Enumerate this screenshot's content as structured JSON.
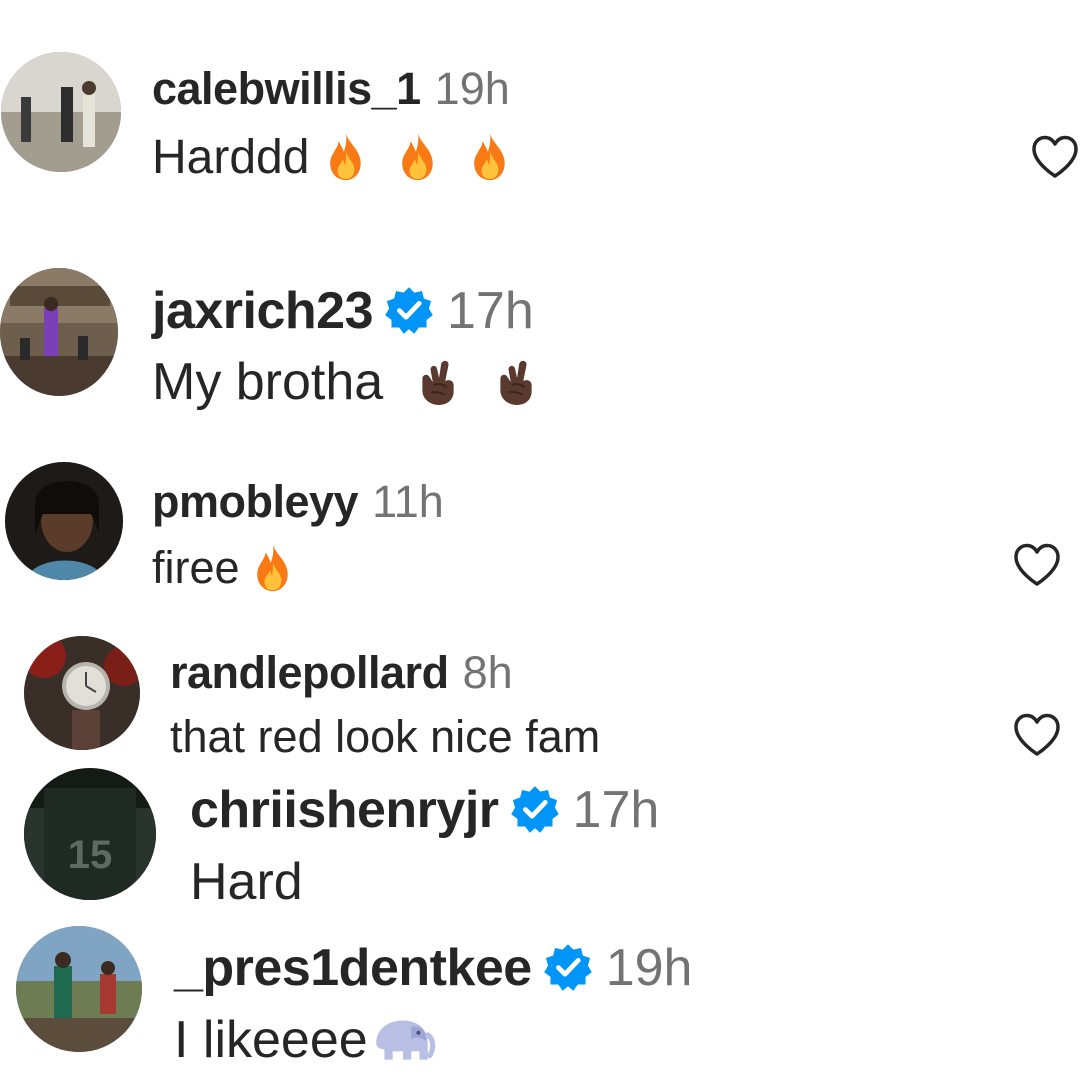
{
  "comments": [
    {
      "username": "calebwillis_1",
      "time": "19h",
      "text": "Harddd",
      "verified": false,
      "emoji": [
        "fire-emoji",
        "fire-emoji",
        "fire-emoji"
      ],
      "has_like_button": true
    },
    {
      "username": "jaxrich23",
      "time": "17h",
      "text": "My brotha",
      "verified": true,
      "emoji": [
        "crossed-fingers-emoji",
        "crossed-fingers-emoji"
      ],
      "has_like_button": false
    },
    {
      "username": "pmobleyy",
      "time": "11h",
      "text": "firee",
      "verified": false,
      "emoji": [
        "fire-emoji"
      ],
      "has_like_button": true
    },
    {
      "username": "randlepollard",
      "time": "8h",
      "text": "that red look nice fam",
      "verified": false,
      "emoji": [],
      "has_like_button": true
    },
    {
      "username": "chriishenryjr",
      "time": "17h",
      "text": "Hard",
      "verified": true,
      "emoji": [],
      "has_like_button": false
    },
    {
      "username": "_pres1dentkee",
      "time": "19h",
      "text": "I likeeee",
      "verified": true,
      "emoji": [
        "elephant-emoji"
      ],
      "has_like_button": false
    }
  ],
  "colors": {
    "text": "#262626",
    "secondary": "#737373",
    "verified": "#0095f6",
    "heart": "#262626"
  }
}
